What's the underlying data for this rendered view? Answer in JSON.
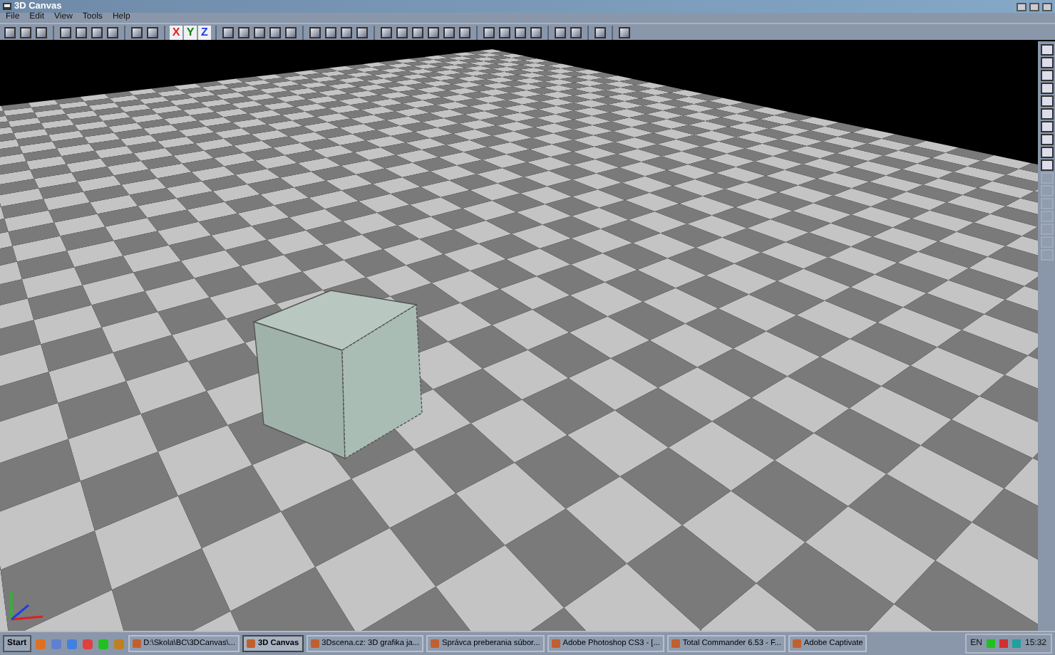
{
  "window": {
    "title": "3D Canvas"
  },
  "menu": [
    "File",
    "Edit",
    "View",
    "Tools",
    "Help"
  ],
  "toolbar": [
    {
      "kind": "icon"
    },
    {
      "kind": "icon"
    },
    {
      "kind": "icon"
    },
    {
      "kind": "sep"
    },
    {
      "kind": "icon"
    },
    {
      "kind": "icon"
    },
    {
      "kind": "icon"
    },
    {
      "kind": "icon"
    },
    {
      "kind": "sep"
    },
    {
      "kind": "icon"
    },
    {
      "kind": "icon"
    },
    {
      "kind": "sep"
    },
    {
      "kind": "axis",
      "label": "X",
      "color": "#e02020"
    },
    {
      "kind": "axis",
      "label": "Y",
      "color": "#108010"
    },
    {
      "kind": "axis",
      "label": "Z",
      "color": "#2040e0"
    },
    {
      "kind": "sep"
    },
    {
      "kind": "icon"
    },
    {
      "kind": "icon"
    },
    {
      "kind": "icon"
    },
    {
      "kind": "icon"
    },
    {
      "kind": "icon"
    },
    {
      "kind": "sep"
    },
    {
      "kind": "icon"
    },
    {
      "kind": "icon"
    },
    {
      "kind": "icon"
    },
    {
      "kind": "icon"
    },
    {
      "kind": "sep"
    },
    {
      "kind": "icon"
    },
    {
      "kind": "icon"
    },
    {
      "kind": "icon"
    },
    {
      "kind": "icon"
    },
    {
      "kind": "icon"
    },
    {
      "kind": "icon"
    },
    {
      "kind": "sep"
    },
    {
      "kind": "icon"
    },
    {
      "kind": "icon"
    },
    {
      "kind": "icon"
    },
    {
      "kind": "icon"
    },
    {
      "kind": "sep"
    },
    {
      "kind": "icon"
    },
    {
      "kind": "icon"
    },
    {
      "kind": "sep"
    },
    {
      "kind": "icon"
    },
    {
      "kind": "sep"
    },
    {
      "kind": "icon"
    }
  ],
  "side_toolbar": [
    {
      "disabled": false
    },
    {
      "disabled": false
    },
    {
      "disabled": false
    },
    {
      "disabled": false
    },
    {
      "disabled": false
    },
    {
      "disabled": false
    },
    {
      "disabled": false
    },
    {
      "disabled": false
    },
    {
      "disabled": false
    },
    {
      "disabled": false
    },
    {
      "disabled": true
    },
    {
      "disabled": true
    },
    {
      "disabled": true
    },
    {
      "disabled": true
    },
    {
      "disabled": true
    },
    {
      "disabled": true
    },
    {
      "disabled": true
    }
  ],
  "taskbar": {
    "start": "Start",
    "tasks": [
      {
        "label": "D:\\Skola\\BC\\3DCanvas\\...",
        "selected": false
      },
      {
        "label": "3D Canvas",
        "selected": true
      },
      {
        "label": "3Dscena.cz: 3D grafika ja...",
        "selected": false
      },
      {
        "label": "Správca preberania súbor...",
        "selected": false
      },
      {
        "label": "Adobe Photoshop CS3 - [...",
        "selected": false
      },
      {
        "label": "Total Commander 6.53 - F...",
        "selected": false
      },
      {
        "label": "Adobe Captivate",
        "selected": false
      }
    ],
    "language": "EN",
    "clock": "15:32"
  }
}
